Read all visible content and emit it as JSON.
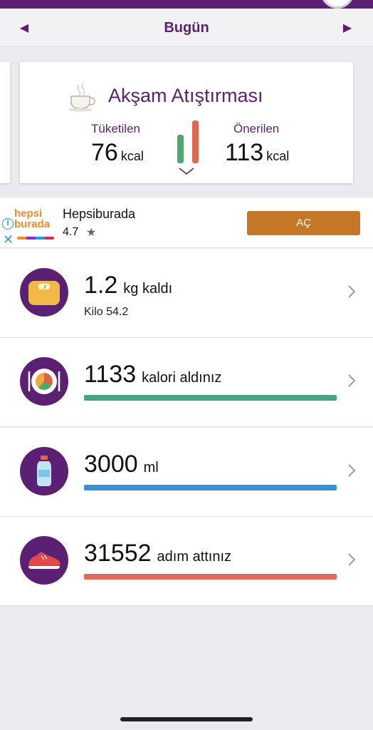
{
  "header": {
    "date_label": "Bugün"
  },
  "meal_card": {
    "title": "Akşam Atıştırması",
    "consumed_label": "Tüketilen",
    "consumed_value": "76",
    "recommended_label": "Önerilen",
    "recommended_value": "113",
    "unit": "kcal",
    "colors": {
      "consumed": "#4fa86b",
      "recommended": "#e0684f"
    }
  },
  "ad": {
    "logo_line1": "hepsi",
    "logo_line2": "burada",
    "name": "Hepsiburada",
    "rating": "4.7",
    "button_label": "AÇ"
  },
  "rows": {
    "weight": {
      "value": "1.2",
      "unit": "kg kaldı",
      "sub": "Kilo 54.2"
    },
    "calorie": {
      "value": "1133",
      "unit": "kalori aldınız",
      "progress": 1.0,
      "color": "#45a482"
    },
    "water": {
      "value": "3000",
      "unit": "ml",
      "progress": 1.0,
      "color": "#3d8fcf"
    },
    "steps": {
      "value": "31552",
      "unit": "adım attınız",
      "progress": 1.0,
      "color": "#e06b5a"
    }
  },
  "colors": {
    "brand": "#5b1f73",
    "ad_button": "#c57728"
  },
  "icons": [
    "chevron-left-icon",
    "chevron-right-icon",
    "cup-icon",
    "scale-icon",
    "plate-icon",
    "water-bottle-icon",
    "shoe-icon",
    "info-icon",
    "close-icon",
    "star-icon"
  ]
}
